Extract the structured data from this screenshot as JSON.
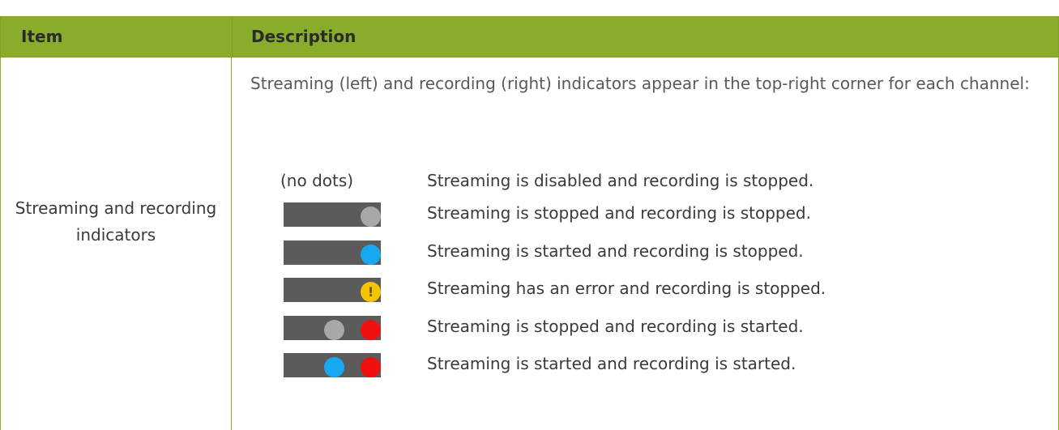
{
  "table": {
    "headers": {
      "item": "Item",
      "description": "Description"
    },
    "row": {
      "item_label": "Streaming and recording indicators",
      "intro": "Streaming (left) and recording (right) indicators appear in the top-right corner for each channel:",
      "states": [
        {
          "indicator_text": "(no dots)",
          "description": "Streaming is disabled and recording is stopped.",
          "streaming_dot": "none",
          "recording_dot": "none"
        },
        {
          "description": "Streaming is stopped and recording is stopped.",
          "streaming_dot": "none",
          "recording_dot": "gray"
        },
        {
          "description": "Streaming is started and recording is stopped.",
          "streaming_dot": "none",
          "recording_dot": "blue"
        },
        {
          "description": "Streaming has an error and recording is stopped.",
          "streaming_dot": "none",
          "recording_dot": "yellow-warning",
          "warning_glyph": "!"
        },
        {
          "description": "Streaming is stopped and recording is started.",
          "streaming_dot": "gray",
          "recording_dot": "red"
        },
        {
          "description": "Streaming is started and recording is started.",
          "streaming_dot": "blue",
          "recording_dot": "red"
        }
      ]
    }
  },
  "colors": {
    "header_bg": "#8aac2c",
    "indicator_bg": "#5b5b5b",
    "dot_gray": "#a8a8a8",
    "dot_blue": "#16a9f0",
    "dot_yellow": "#f5c400",
    "dot_red": "#f01010"
  }
}
